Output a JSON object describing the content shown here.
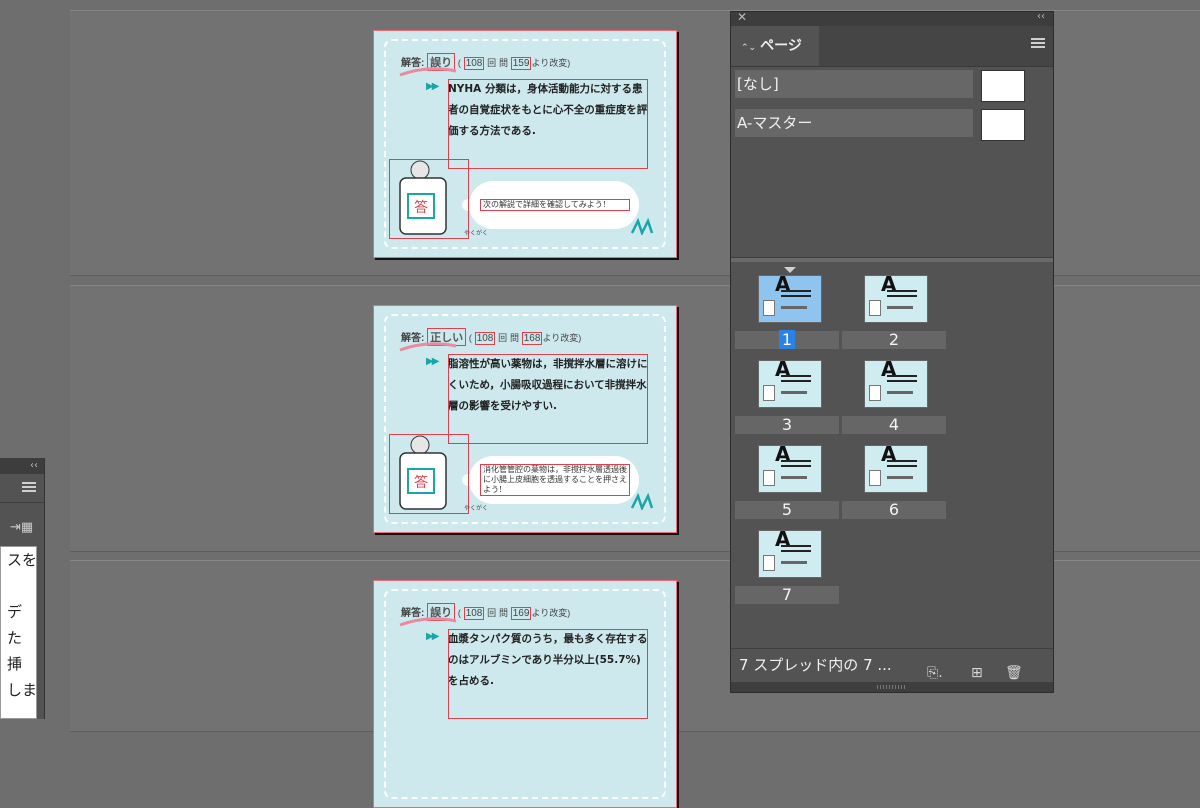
{
  "pages": [
    {
      "answer_label": "解答:",
      "verdict": "誤り",
      "open_paren": "(",
      "exam_no": "108",
      "kai": "回",
      "mon": "問",
      "question_no": "159",
      "suffix": "より改変)",
      "body": "NYHA 分類は，身体活動能力に対する患者の自覚症状をもとに心不全の重症度を評価する方法である.",
      "bubble": "次の解説で詳細を確認してみよう!",
      "stamp": "答",
      "credit": "やくがく"
    },
    {
      "answer_label": "解答:",
      "verdict": "正しい",
      "open_paren": "(",
      "exam_no": "108",
      "kai": "回",
      "mon": "問",
      "question_no": "168",
      "suffix": "より改変)",
      "body": "脂溶性が高い薬物は，非撹拌水層に溶けにくいため，小腸吸収過程において非撹拌水層の影響を受けやすい.",
      "bubble": "消化管管腔の薬物は，非撹拌水層透過後に小腸上皮細胞を透過することを押さえよう!",
      "stamp": "答",
      "credit": "やくがく"
    },
    {
      "answer_label": "解答:",
      "verdict": "誤り",
      "open_paren": "(",
      "exam_no": "108",
      "kai": "回",
      "mon": "問",
      "question_no": "169",
      "suffix": "より改変)",
      "body": "血漿タンパク質のうち，最も多く存在するのはアルブミンであり半分以上(55.7%)を占める."
    }
  ],
  "pages_panel": {
    "tab_label": "ページ",
    "masters": [
      "[なし]",
      "A-マスター"
    ],
    "thumbnails": [
      {
        "number": "1",
        "selected": true
      },
      {
        "number": "2",
        "selected": false
      },
      {
        "number": "3",
        "selected": false
      },
      {
        "number": "4",
        "selected": false
      },
      {
        "number": "5",
        "selected": false
      },
      {
        "number": "6",
        "selected": false
      },
      {
        "number": "7",
        "selected": false
      }
    ],
    "thumb_letter": "A",
    "status": "7 スプレッド内の 7 ..."
  },
  "left_panel": {
    "doc_lines": [
      "スを",
      "",
      "デ",
      "た",
      "挿",
      "しま"
    ]
  },
  "colors": {
    "page_bg": "#cde9ee",
    "frame_red": "#e0404e",
    "teal": "#1aa5a7",
    "selection_blue": "#2a82e4"
  }
}
